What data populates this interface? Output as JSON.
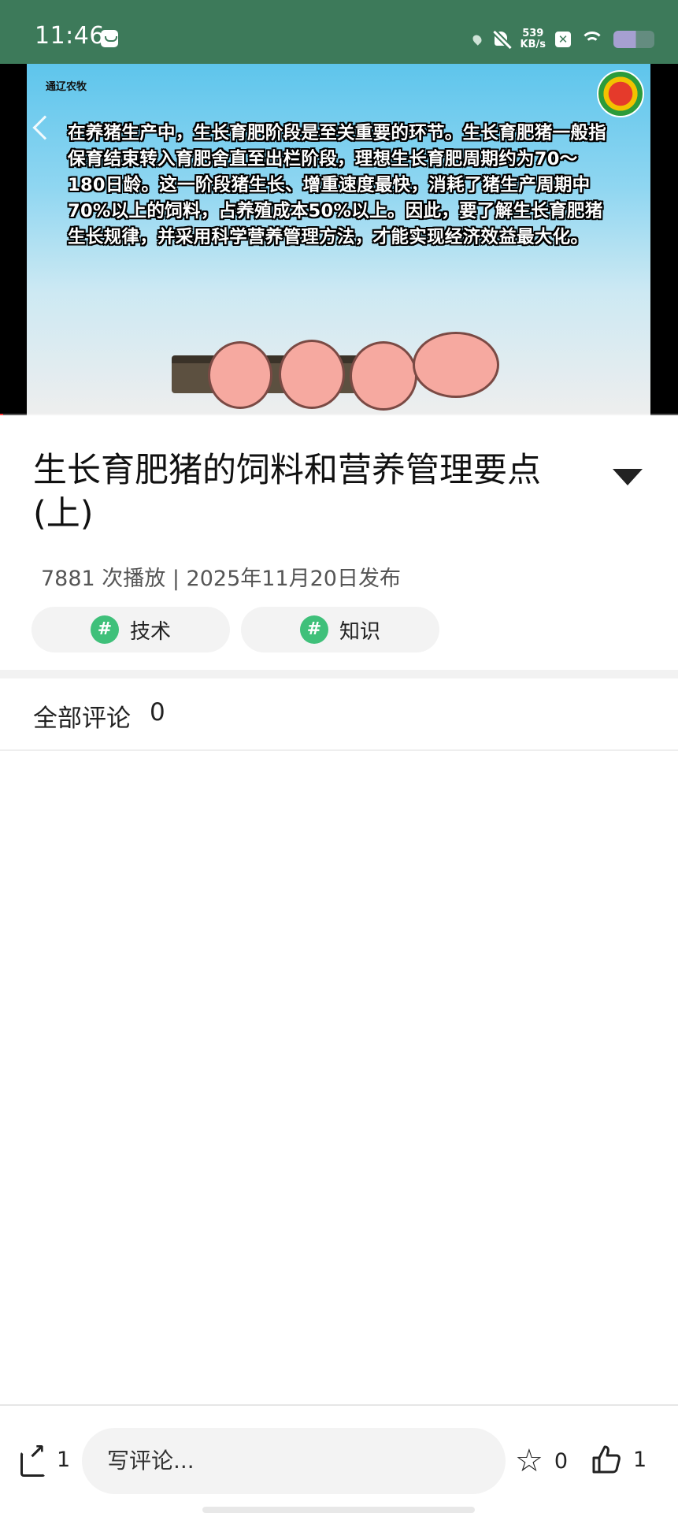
{
  "status_bar": {
    "time": "11:46",
    "net_speed_value": "539",
    "net_speed_unit": "KB/s"
  },
  "video": {
    "channel_name": "通辽农牧",
    "subtitle": "在养猪生产中，生长育肥阶段是至关重要的环节。生长育肥猪一般指保育结束转入育肥舍直至出栏阶段，理想生长育肥周期约为70～180日龄。这一阶段猪生长、增重速度最快，消耗了猪生产周期中70%以上的饲料，占养殖成本50%以上。因此，要了解生长育肥猪生长规律，并采用科学营养管理方法，才能实现经济效益最大化。",
    "progress_fraction": 0.005
  },
  "article": {
    "title": "生长育肥猪的饲料和营养管理要点(上)",
    "meta": "7881 次播放 | 2025年11月20日发布",
    "tags": [
      {
        "hash": "#",
        "label": "技术"
      },
      {
        "hash": "#",
        "label": "知识"
      }
    ]
  },
  "comments": {
    "header_label": "全部评论",
    "count": "0"
  },
  "bottom_bar": {
    "share_count": "1",
    "input_placeholder": "写评论...",
    "favorite_count": "0",
    "like_count": "1"
  }
}
